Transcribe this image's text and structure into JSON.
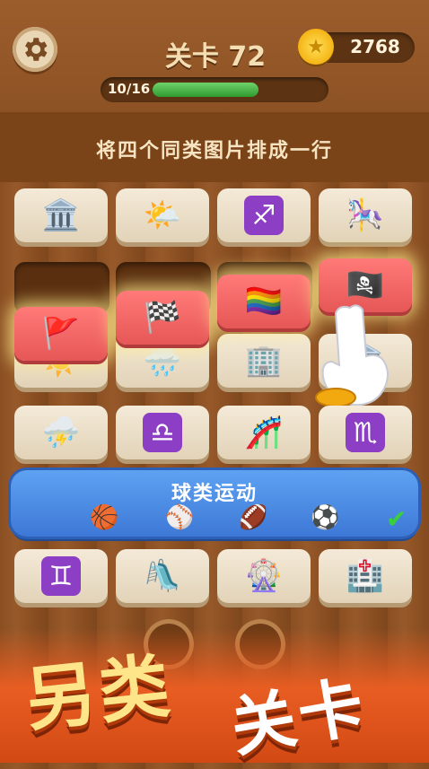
{
  "header": {
    "level_label": "关卡 72",
    "coins": "2768"
  },
  "progress": {
    "text": "10/16",
    "current": 10,
    "total": 16
  },
  "hint": "将四个同类图片排成一行",
  "rows": [
    [
      "🏛️",
      "🌤️",
      "♐",
      "🎠"
    ],
    [
      "☀️",
      "🌧️",
      "🏢",
      "🏛️"
    ],
    [
      "⛈️",
      "♎",
      "🎢",
      "♏"
    ],
    [
      "♊",
      "🛝",
      "🎡",
      "🏥"
    ]
  ],
  "flags": [
    "🚩",
    "🏁",
    "🏳️‍🌈",
    "🏴‍☠️"
  ],
  "solved_group": {
    "title": "球类运动",
    "items": [
      "🏀",
      "⚾",
      "🏈",
      "⚽"
    ],
    "check": "✔"
  },
  "promo": {
    "line1": "另类",
    "line2": "关卡"
  },
  "colors": {
    "accent_red": "#e65757",
    "solved_blue": "#3d78d6",
    "progress_green": "#2f9a2f"
  }
}
